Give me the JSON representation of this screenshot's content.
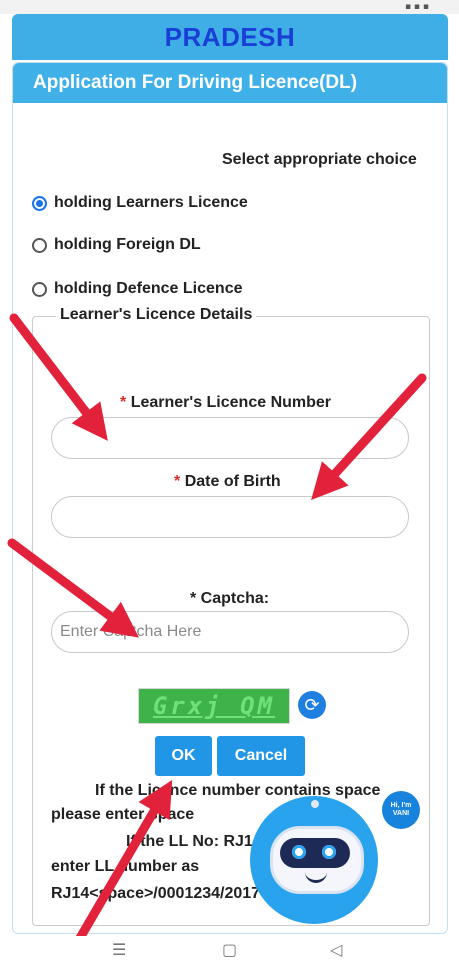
{
  "header": {
    "title": "PRADESH"
  },
  "card": {
    "title": "Application For Driving Licence(DL)"
  },
  "selection": {
    "label": "Select appropriate choice",
    "options": [
      {
        "label": "holding Learners Licence",
        "checked": true
      },
      {
        "label": "holding Foreign DL",
        "checked": false
      },
      {
        "label": "holding Defence Licence",
        "checked": false
      }
    ]
  },
  "details": {
    "legend": "Learner's Licence Details",
    "ll_number_label": "Learner's Licence Number",
    "dob_label": "Date of Birth",
    "required_mark": "*",
    "captcha_label": "* Captcha:",
    "captcha_placeholder": "Enter Captcha Here",
    "captcha_text": "Grxj QM",
    "ok_label": "OK",
    "cancel_label": "Cancel"
  },
  "note": {
    "line1": "If the Licence number contains space",
    "line2": "please enter space",
    "line3": "If the LL No: RJ14/0001234/2017",
    "line4": "enter LL number as",
    "line5": "RJ14<space>/0001234/2017"
  },
  "assistant": {
    "bubble": "Hi, I'm VANI"
  },
  "colors": {
    "accent": "#3fb0e8",
    "title": "#1a3fd6",
    "button": "#2196e6",
    "arrow": "#e2223a"
  }
}
